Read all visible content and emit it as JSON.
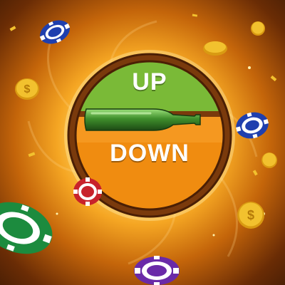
{
  "game": {
    "up_label": "UP",
    "down_label": "DOWN"
  },
  "colors": {
    "up_zone": "#6fae2f",
    "down_zone": "#f08c10",
    "rim": "#7a3a0c",
    "bottle": "#3f8f2c",
    "chip_blue": "#1f3fae",
    "chip_red": "#c8222b",
    "chip_green": "#1c8b3e",
    "chip_purple": "#6a2aa8",
    "coin_gold": "#f2c12e"
  },
  "icons": [
    "bottle-icon",
    "poker-chip-icon",
    "gold-coin-icon",
    "sparkle-icon"
  ]
}
